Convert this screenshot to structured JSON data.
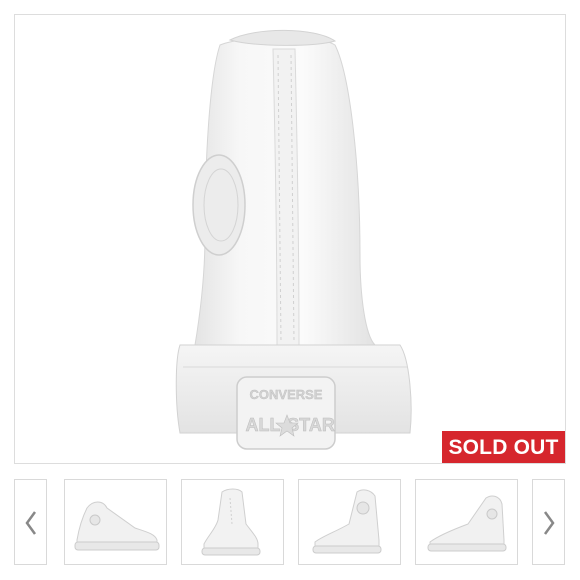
{
  "product_image": {
    "alt": "White leather high-top sneaker, rear view",
    "heel_logo_top": "CONVERSE",
    "heel_logo_left": "ALL",
    "heel_logo_right": "STAR"
  },
  "badge": {
    "label": "SOLD OUT",
    "color": "#d6262d"
  },
  "gallery": {
    "prev_icon": "chevron-left-icon",
    "next_icon": "chevron-right-icon",
    "thumbnails": [
      {
        "view": "side-view"
      },
      {
        "view": "three-quarter-front-view"
      },
      {
        "view": "inner-side-view"
      },
      {
        "view": "opposite-side-view"
      }
    ]
  }
}
